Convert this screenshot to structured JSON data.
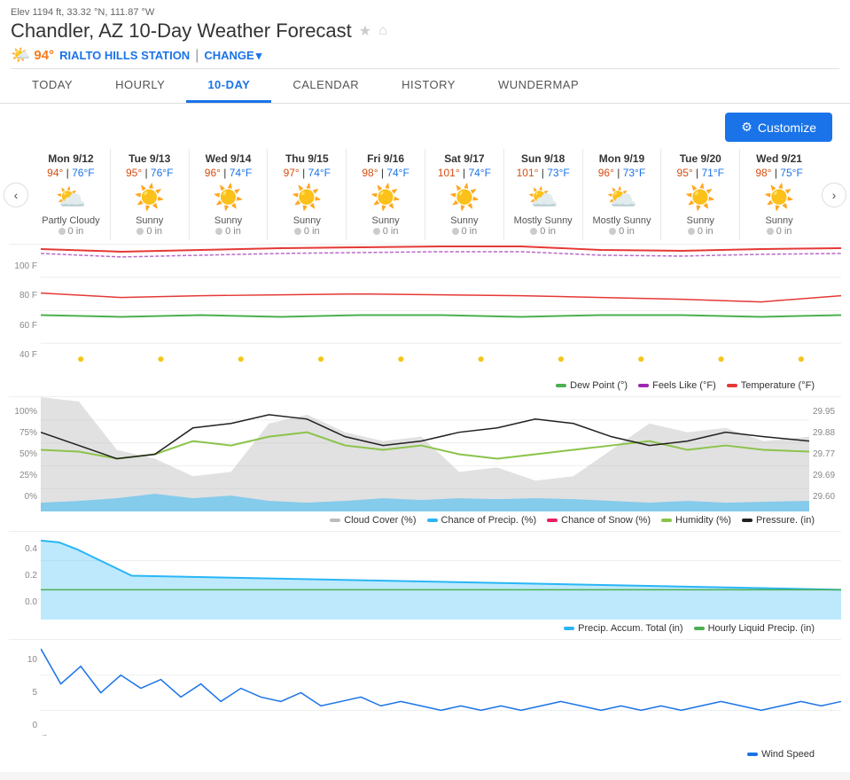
{
  "elev": "Elev 1194 ft, 33.32 °N, 111.87 °W",
  "title": "Chandler, AZ 10-Day Weather Forecast",
  "temp_current": "94°",
  "station": "RIALTO HILLS STATION",
  "change_label": "CHANGE",
  "tabs": [
    "TODAY",
    "HOURLY",
    "10-DAY",
    "CALENDAR",
    "HISTORY",
    "WUNDERMAP"
  ],
  "active_tab": "10-DAY",
  "customize_label": "Customize",
  "days": [
    {
      "label": "Mon 9/12",
      "high": "94°",
      "low": "76°F",
      "icon": "⛅",
      "desc": "Partly Cloudy",
      "precip": "0 in"
    },
    {
      "label": "Tue 9/13",
      "high": "95°",
      "low": "76°F",
      "icon": "☀️",
      "desc": "Sunny",
      "precip": "0 in"
    },
    {
      "label": "Wed 9/14",
      "high": "96°",
      "low": "74°F",
      "icon": "☀️",
      "desc": "Sunny",
      "precip": "0 in"
    },
    {
      "label": "Thu 9/15",
      "high": "97°",
      "low": "74°F",
      "icon": "☀️",
      "desc": "Sunny",
      "precip": "0 in"
    },
    {
      "label": "Fri 9/16",
      "high": "98°",
      "low": "74°F",
      "icon": "☀️",
      "desc": "Sunny",
      "precip": "0 in"
    },
    {
      "label": "Sat 9/17",
      "high": "101°",
      "low": "74°F",
      "icon": "☀️",
      "desc": "Sunny",
      "precip": "0 in"
    },
    {
      "label": "Sun 9/18",
      "high": "101°",
      "low": "73°F",
      "icon": "⛅",
      "desc": "Mostly Sunny",
      "precip": "0 in"
    },
    {
      "label": "Mon 9/19",
      "high": "96°",
      "low": "73°F",
      "icon": "⛅",
      "desc": "Mostly Sunny",
      "precip": "0 in"
    },
    {
      "label": "Tue 9/20",
      "high": "95°",
      "low": "71°F",
      "icon": "☀️",
      "desc": "Sunny",
      "precip": "0 in"
    },
    {
      "label": "Wed 9/21",
      "high": "98°",
      "low": "75°F",
      "icon": "☀️",
      "desc": "Sunny",
      "precip": "0 in"
    }
  ],
  "chart1_legend": [
    {
      "label": "Dew Point (°)",
      "color": "#4caf50"
    },
    {
      "label": "Feels Like (°F)",
      "color": "#9c27b0"
    },
    {
      "label": "Temperature (°F)",
      "color": "#e53935"
    }
  ],
  "chart2_legend": [
    {
      "label": "Cloud Cover (%)",
      "color": "#bbb"
    },
    {
      "label": "Chance of Precip. (%)",
      "color": "#29b6f6"
    },
    {
      "label": "Chance of Snow (%)",
      "color": "#e91e63"
    },
    {
      "label": "Humidity (%)",
      "color": "#8bc34a"
    },
    {
      "label": "Pressure. (in)",
      "color": "#212121"
    }
  ],
  "chart3_legend": [
    {
      "label": "Precip. Accum. Total (in)",
      "color": "#29b6f6"
    },
    {
      "label": "Hourly Liquid Precip. (in)",
      "color": "#4caf50"
    }
  ],
  "chart4_legend": [
    {
      "label": "Wind Speed",
      "color": "#1a73e8"
    }
  ],
  "chart1_y": [
    "100 F",
    "80 F",
    "60 F",
    "40 F"
  ],
  "chart2_y_left": [
    "100%",
    "75%",
    "50%",
    "25%",
    "0%"
  ],
  "chart2_y_right": [
    "29.95",
    "29.88",
    "29.77",
    "29.69",
    "29.60"
  ],
  "chart3_y": [
    "0.4",
    "0.2",
    "0.0"
  ],
  "chart4_y": [
    "10",
    "5",
    "0"
  ]
}
